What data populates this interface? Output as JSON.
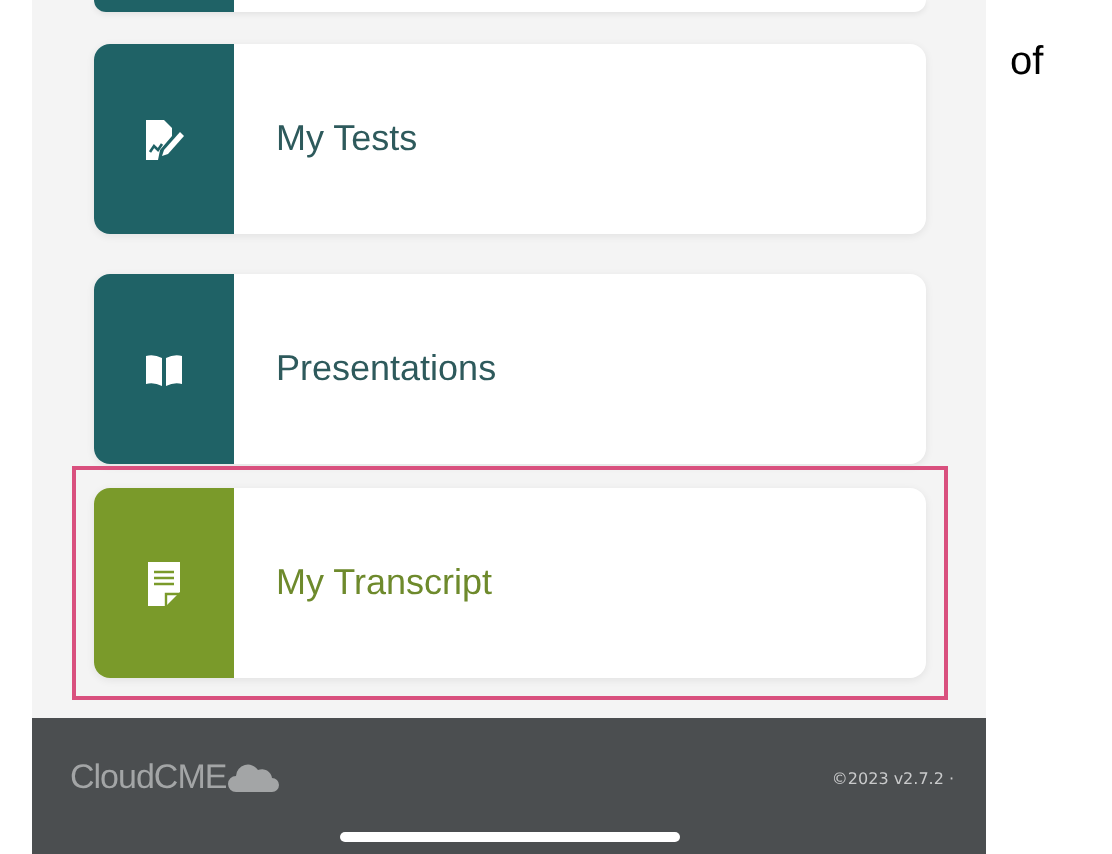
{
  "menu": [
    {
      "label": "My Tests",
      "kind": "tests",
      "color": "#1f6266",
      "selected": false
    },
    {
      "label": "Presentations",
      "kind": "book",
      "color": "#1f6266",
      "selected": false
    },
    {
      "label": "My Transcript",
      "kind": "transcript",
      "color": "#7a9a2a",
      "selected": true
    }
  ],
  "footer": {
    "logo": "CloudCME",
    "version": "©2023 v2.7.2 ·"
  },
  "side_text": "of"
}
